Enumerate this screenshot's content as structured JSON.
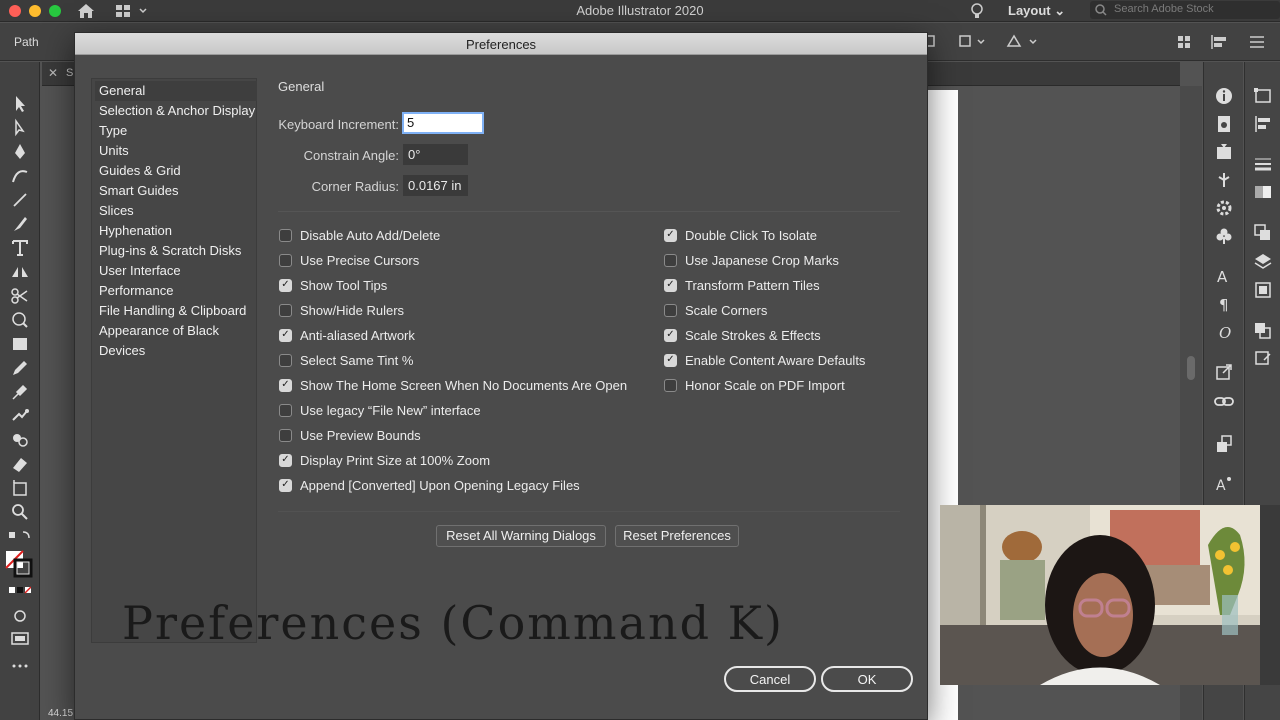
{
  "app": {
    "title": "Adobe Illustrator 2020",
    "layout_label": "Layout",
    "stock_search_placeholder": "Search Adobe Stock"
  },
  "controlbar": {
    "path_label": "Path"
  },
  "doc_tab": {
    "close": "✕",
    "name": "Sl"
  },
  "status": {
    "zoom": "44.15"
  },
  "dialog": {
    "title": "Preferences",
    "categories": [
      "General",
      "Selection & Anchor Display",
      "Type",
      "Units",
      "Guides & Grid",
      "Smart Guides",
      "Slices",
      "Hyphenation",
      "Plug-ins & Scratch Disks",
      "User Interface",
      "Performance",
      "File Handling & Clipboard",
      "Appearance of Black",
      "Devices"
    ],
    "selected_category": "General",
    "section_title": "General",
    "fields": {
      "keyboard_increment": {
        "label": "Keyboard Increment:",
        "value": "5"
      },
      "constrain_angle": {
        "label": "Constrain Angle:",
        "value": "0°"
      },
      "corner_radius": {
        "label": "Corner Radius:",
        "value": "0.0167 in"
      }
    },
    "left_checks": [
      {
        "label": "Disable Auto Add/Delete",
        "checked": false
      },
      {
        "label": "Use Precise Cursors",
        "checked": false
      },
      {
        "label": "Show Tool Tips",
        "checked": true
      },
      {
        "label": "Show/Hide Rulers",
        "checked": false
      },
      {
        "label": "Anti-aliased Artwork",
        "checked": true
      },
      {
        "label": "Select Same Tint %",
        "checked": false
      },
      {
        "label": "Show The Home Screen When No Documents Are Open",
        "checked": true
      },
      {
        "label": "Use legacy “File New” interface",
        "checked": false
      },
      {
        "label": "Use Preview Bounds",
        "checked": false
      },
      {
        "label": "Display Print Size at 100% Zoom",
        "checked": true
      },
      {
        "label": "Append [Converted] Upon Opening Legacy Files",
        "checked": true
      }
    ],
    "right_checks": [
      {
        "label": "Double Click To Isolate",
        "checked": true
      },
      {
        "label": "Use Japanese Crop Marks",
        "checked": false
      },
      {
        "label": "Transform Pattern Tiles",
        "checked": true
      },
      {
        "label": "Scale Corners",
        "checked": false
      },
      {
        "label": "Scale Strokes & Effects",
        "checked": true
      },
      {
        "label": "Enable Content Aware Defaults",
        "checked": true
      },
      {
        "label": "Honor Scale on PDF Import",
        "checked": false
      }
    ],
    "buttons": {
      "reset_warnings": "Reset All Warning Dialogs",
      "reset_prefs": "Reset Preferences",
      "cancel": "Cancel",
      "ok": "OK"
    },
    "check_glyph": "✓"
  },
  "overlay": {
    "caption": "Preferences (Command K)"
  },
  "colors": {
    "dialog_bg": "#4b4b4b",
    "app_bg": "#535353",
    "focus_ring": "#7fb1f5"
  },
  "icons": {
    "toolbar": [
      "selection-tool-icon",
      "direct-selection-tool-icon",
      "pen-tool-icon",
      "curvature-tool-icon",
      "line-tool-icon",
      "paintbrush-tool-icon",
      "type-tool-icon",
      "reflect-tool-icon",
      "scissors-tool-icon",
      "warp-tool-icon",
      "rectangle-tool-icon",
      "pencil-tool-icon",
      "eyedropper-tool-icon",
      "puppet-warp-tool-icon",
      "shape-builder-tool-icon",
      "eraser-tool-icon",
      "artboard-tool-icon",
      "zoom-tool-icon",
      "swap-colors-icon",
      "fill-stroke-icon",
      "color-mode-icon",
      "screen-mode-icon",
      "more-tools-icon"
    ],
    "panels": [
      "info-icon",
      "document-info-icon",
      "export-icon",
      "puppet-icon",
      "gear-icon",
      "clubs-icon",
      "character-icon",
      "paragraph-icon",
      "opentype-icon",
      "share-icon",
      "links-icon",
      "asset-export-icon",
      "font-icon"
    ]
  }
}
